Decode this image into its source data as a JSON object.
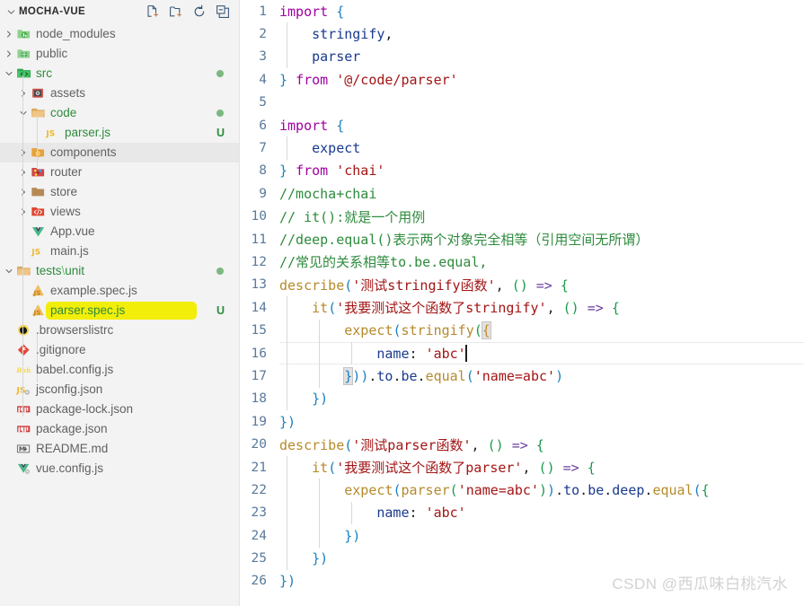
{
  "explorer": {
    "chevron": "chevron-down-icon",
    "title": "MOCHA-VUE",
    "actions": [
      {
        "name": "new-file-icon",
        "label": "New File"
      },
      {
        "name": "new-folder-icon",
        "label": "New Folder"
      },
      {
        "name": "refresh-icon",
        "label": "Refresh Explorer"
      },
      {
        "name": "collapse-all-icon",
        "label": "Collapse Folders in Explorer"
      }
    ],
    "items": [
      {
        "label": "node_modules",
        "icon": "folder-node-modules-icon",
        "type": "folder",
        "state": "collapsed",
        "depth": 1,
        "color": "gray",
        "badge": "",
        "dot": false
      },
      {
        "label": "public",
        "icon": "folder-public-icon",
        "type": "folder",
        "state": "collapsed",
        "depth": 1,
        "color": "gray",
        "badge": "",
        "dot": false
      },
      {
        "label": "src",
        "icon": "folder-src-icon",
        "type": "folder",
        "state": "expanded",
        "depth": 1,
        "color": "green",
        "badge": "",
        "dot": true
      },
      {
        "label": "assets",
        "icon": "folder-assets-icon",
        "type": "folder",
        "state": "collapsed",
        "depth": 2,
        "color": "gray",
        "badge": "",
        "dot": false
      },
      {
        "label": "code",
        "icon": "folder-open-icon",
        "type": "folder",
        "state": "expanded",
        "depth": 2,
        "color": "green",
        "badge": "",
        "dot": true
      },
      {
        "label": "parser.js",
        "icon": "js-file-icon",
        "type": "file",
        "state": "none",
        "depth": 3,
        "color": "green",
        "badge": "U",
        "dot": false
      },
      {
        "label": "components",
        "icon": "folder-components-icon",
        "type": "folder",
        "state": "collapsed",
        "depth": 2,
        "color": "gray",
        "badge": "",
        "dot": false,
        "hovered": true
      },
      {
        "label": "router",
        "icon": "folder-router-icon",
        "type": "folder",
        "state": "collapsed",
        "depth": 2,
        "color": "gray",
        "badge": "",
        "dot": false
      },
      {
        "label": "store",
        "icon": "folder-store-icon",
        "type": "folder",
        "state": "collapsed",
        "depth": 2,
        "color": "gray",
        "badge": "",
        "dot": false
      },
      {
        "label": "views",
        "icon": "folder-views-icon",
        "type": "folder",
        "state": "collapsed",
        "depth": 2,
        "color": "gray",
        "badge": "",
        "dot": false
      },
      {
        "label": "App.vue",
        "icon": "vue-file-icon",
        "type": "file",
        "state": "none",
        "depth": 2,
        "color": "gray",
        "badge": "",
        "dot": false
      },
      {
        "label": "main.js",
        "icon": "js-file-icon",
        "type": "file",
        "state": "none",
        "depth": 2,
        "color": "gray",
        "badge": "",
        "dot": false
      },
      {
        "label": "tests\\unit",
        "icon": "folder-open-icon",
        "type": "folder",
        "state": "expanded",
        "depth": 1,
        "color": "green",
        "badge": "",
        "dot": true,
        "sep": "\\"
      },
      {
        "label": "example.spec.js",
        "icon": "js-test-file-icon",
        "type": "file",
        "state": "none",
        "depth": 2,
        "color": "gray",
        "badge": "",
        "dot": false
      },
      {
        "label": "parser.spec.js",
        "icon": "js-test-file-icon",
        "type": "file",
        "state": "none",
        "depth": 2,
        "color": "green",
        "badge": "U",
        "dot": false,
        "highlighted": true
      },
      {
        "label": ".browserslistrc",
        "icon": "browserslist-file-icon",
        "type": "file",
        "state": "none",
        "depth": 1,
        "color": "gray",
        "badge": "",
        "dot": false
      },
      {
        "label": ".gitignore",
        "icon": "git-file-icon",
        "type": "file",
        "state": "none",
        "depth": 1,
        "color": "gray",
        "badge": "",
        "dot": false
      },
      {
        "label": "babel.config.js",
        "icon": "babel-file-icon",
        "type": "file",
        "state": "none",
        "depth": 1,
        "color": "gray",
        "badge": "",
        "dot": false
      },
      {
        "label": "jsconfig.json",
        "icon": "jsconfig-file-icon",
        "type": "file",
        "state": "none",
        "depth": 1,
        "color": "gray",
        "badge": "",
        "dot": false
      },
      {
        "label": "package-lock.json",
        "icon": "npm-file-icon",
        "type": "file",
        "state": "none",
        "depth": 1,
        "color": "gray",
        "badge": "",
        "dot": false
      },
      {
        "label": "package.json",
        "icon": "npm-file-icon",
        "type": "file",
        "state": "none",
        "depth": 1,
        "color": "gray",
        "badge": "",
        "dot": false
      },
      {
        "label": "README.md",
        "icon": "markdown-file-icon",
        "type": "file",
        "state": "none",
        "depth": 1,
        "color": "gray",
        "badge": "",
        "dot": false
      },
      {
        "label": "vue.config.js",
        "icon": "vue-config-file-icon",
        "type": "file",
        "state": "none",
        "depth": 1,
        "color": "gray",
        "badge": "",
        "dot": false
      }
    ]
  },
  "editor": {
    "language": "javascript",
    "cursor_line": 16,
    "lines": [
      {
        "n": "1",
        "text": "import {"
      },
      {
        "n": "2",
        "text": "    stringify,"
      },
      {
        "n": "3",
        "text": "    parser"
      },
      {
        "n": "4",
        "text": "} from '@/code/parser'"
      },
      {
        "n": "5",
        "text": ""
      },
      {
        "n": "6",
        "text": "import {"
      },
      {
        "n": "7",
        "text": "    expect"
      },
      {
        "n": "8",
        "text": "} from 'chai'"
      },
      {
        "n": "9",
        "text": "//mocha+chai"
      },
      {
        "n": "10",
        "text": "// it():就是一个用例"
      },
      {
        "n": "11",
        "text": "//deep.equal()表示两个对象完全相等（引用空间无所谓）"
      },
      {
        "n": "12",
        "text": "//常见的关系相等to.be.equal,"
      },
      {
        "n": "13",
        "text": "describe('测试stringify函数', () => {"
      },
      {
        "n": "14",
        "text": "    it('我要测试这个函数了stringify', () => {"
      },
      {
        "n": "15",
        "text": "        expect(stringify({"
      },
      {
        "n": "16",
        "text": "            name: 'abc'"
      },
      {
        "n": "17",
        "text": "        })).to.be.equal('name=abc')"
      },
      {
        "n": "18",
        "text": "    })"
      },
      {
        "n": "19",
        "text": "})"
      },
      {
        "n": "20",
        "text": "describe('测试parser函数', () => {"
      },
      {
        "n": "21",
        "text": "    it('我要测试这个函数了parser', () => {"
      },
      {
        "n": "22",
        "text": "        expect(parser('name=abc')).to.be.deep.equal({"
      },
      {
        "n": "23",
        "text": "            name: 'abc'"
      },
      {
        "n": "24",
        "text": "        })"
      },
      {
        "n": "25",
        "text": "    })"
      },
      {
        "n": "26",
        "text": "})"
      }
    ]
  },
  "watermark": {
    "text": "CSDN @西瓜味白桃汽水"
  },
  "colors": {
    "sidebar_bg": "#f3f3f3",
    "editor_bg": "#ffffff",
    "keyword": "#a000a0",
    "string": "#a31515",
    "comment": "#2e8b3d",
    "identifier": "#1a3a8f",
    "function": "#b58a2b",
    "linenumber": "#5a7a9b",
    "highlight_marker": "#f2ee0a",
    "untracked": "#2e8b3d"
  }
}
